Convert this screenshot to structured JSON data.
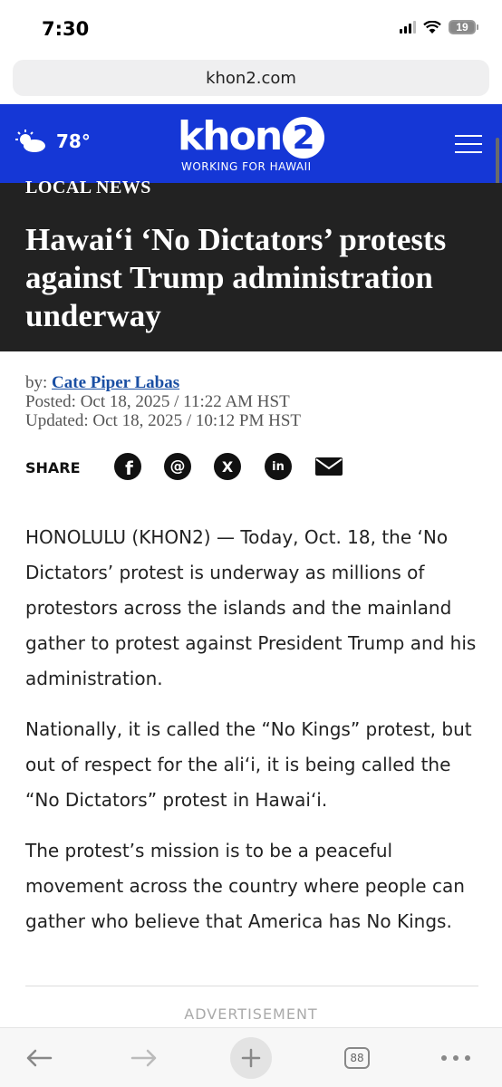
{
  "status_bar": {
    "time": "7:30",
    "battery": "19"
  },
  "browser": {
    "url": "khon2.com"
  },
  "site_header": {
    "weather_temp": "78°",
    "logo_word": "khon",
    "logo_number": "2",
    "logo_tagline": "WORKING FOR HAWAII",
    "accent_color": "#1537d6"
  },
  "article": {
    "category": "LOCAL NEWS",
    "title": "Hawai‘i ‘No Dictators’ protests against Trump administration underway",
    "byline_prefix": "by:",
    "author": "Cate Piper Labas",
    "posted": "Posted: Oct 18, 2025 / 11:22 AM HST",
    "updated": "Updated: Oct 18, 2025 / 10:12 PM HST",
    "share_label": "SHARE",
    "share_icons": [
      "facebook-icon",
      "threads-icon",
      "x-icon",
      "linkedin-icon",
      "email-icon"
    ],
    "paragraphs": [
      "HONOLULU (KHON2) — Today, Oct. 18, the ‘No Dictators’ protest is underway as millions of protestors across the islands and the mainland gather to protest against President Trump and his administration.",
      "Nationally, it is called the “No Kings” protest, but out of respect for the ali‘i, it is being called the “No Dictators” protest in Hawai‘i.",
      "The protest’s mission is to be a peaceful movement across the country where people can gather who believe that America has No Kings."
    ],
    "advertisement_label": "ADVERTISEMENT"
  },
  "toolbar": {
    "tabs_count": "88",
    "icons": [
      "back-icon",
      "forward-icon",
      "plus-icon",
      "tabs-icon",
      "more-icon"
    ]
  }
}
